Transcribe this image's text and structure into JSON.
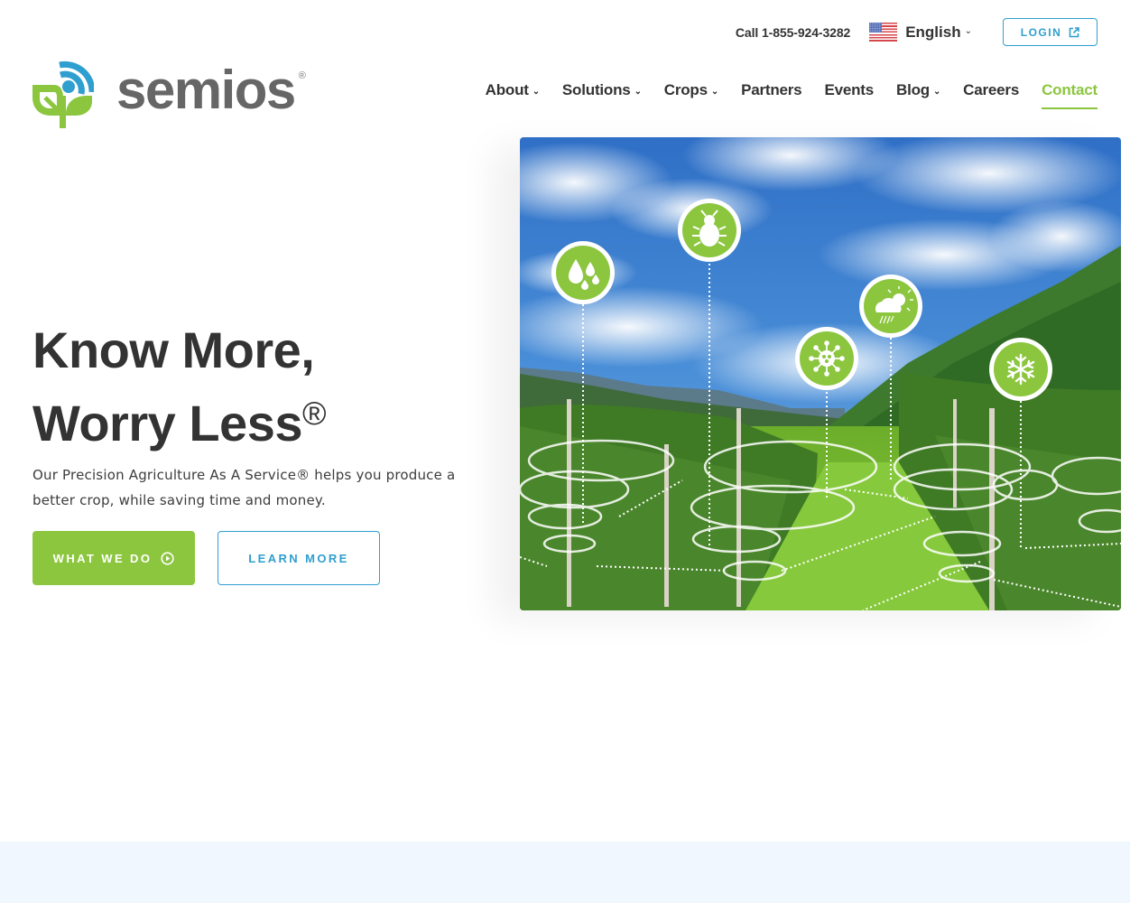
{
  "topbar": {
    "call_label": "Call 1-855-924-3282",
    "language": {
      "label": "English",
      "flag_icon": "us-flag-icon"
    },
    "login_label": "LOGIN"
  },
  "logo": {
    "wordmark": "semios",
    "registered": "®"
  },
  "nav": {
    "items": [
      {
        "label": "About",
        "has_dropdown": true
      },
      {
        "label": "Solutions",
        "has_dropdown": true
      },
      {
        "label": "Crops",
        "has_dropdown": true
      },
      {
        "label": "Partners",
        "has_dropdown": false
      },
      {
        "label": "Events",
        "has_dropdown": false
      },
      {
        "label": "Blog",
        "has_dropdown": true
      },
      {
        "label": "Careers",
        "has_dropdown": false
      },
      {
        "label": "Contact",
        "has_dropdown": false,
        "active": true
      }
    ],
    "chevron": "⌄"
  },
  "hero": {
    "title_line1": "Know More,",
    "title_line2": "Worry Less",
    "title_reg": "®",
    "subtitle": "Our Precision Agriculture As A Service® helps you produce a better crop, while saving time and money.",
    "primary_button": "WHAT WE DO",
    "secondary_button": "LEARN MORE",
    "image": {
      "description": "Apple orchard under blue sky with sensor icons",
      "icons": [
        "water-drops-icon",
        "bug-icon",
        "virus-icon",
        "weather-icon",
        "snowflake-icon"
      ]
    }
  },
  "colors": {
    "brand_green": "#8cc63f",
    "brand_blue": "#2f9fcf",
    "text_dark": "#333333",
    "logo_gray": "#666666",
    "band_bg": "#f1f7fe"
  }
}
